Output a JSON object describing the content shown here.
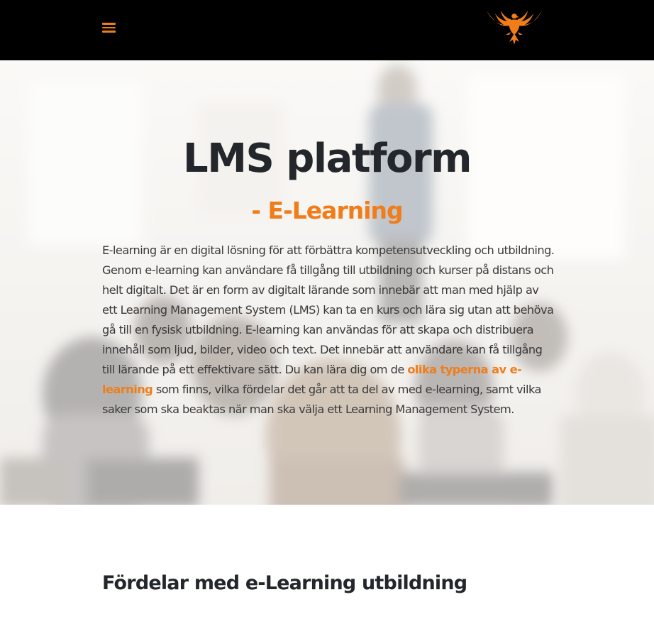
{
  "header": {
    "menu_icon": "hamburger-menu-icon",
    "logo_icon": "phoenix-eagle-logo",
    "accent_color": "#f07d1a",
    "background_color": "#000000"
  },
  "hero": {
    "title": "LMS platform",
    "subtitle": "- E-Learning",
    "paragraph_before_link": "E-learning är en digital lösning för att förbättra kompetensutveckling och utbildning. Genom e-learning kan användare få tillgång till utbildning och kurser på distans och helt digitalt. Det är en form av digitalt lärande som innebär att man med hjälp av ett Learning Management System (LMS) kan ta en kurs och lära sig utan att behöva gå till en fysisk utbildning. E-learning kan användas för att skapa och distribuera innehåll som ljud, bilder, video och text. Det innebär att användare kan få tillgång till lärande på ett effektivare sätt. Du kan lära dig om de ",
    "link_text": "olika typerna av e-learning",
    "paragraph_after_link": " som finns, vilka fördelar det går att ta del av med e-learning, samt vilka saker som ska beaktas när man ska välja ett Learning Management System."
  },
  "section": {
    "heading": "Fördelar med e-Learning utbildning"
  }
}
